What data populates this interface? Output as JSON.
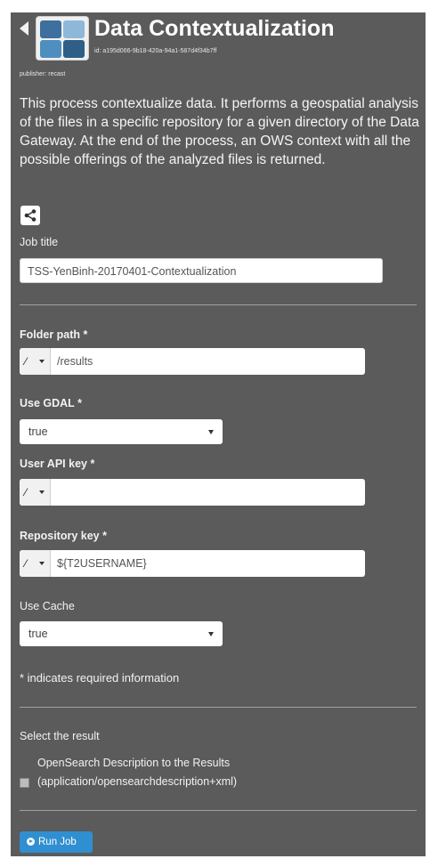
{
  "header": {
    "title": "Data Contextualization",
    "id_text": "id: a195d066-9b18-420a-94a1-587d4f34b7ff",
    "publisher": "publisher: recast"
  },
  "description": "This process contextualize data. It performs a geospatial analysis of the files in a specific repository for a given directory of the Data Gateway. At the end of the process, an OWS context with all the possible offerings of the analyzed files is returned.",
  "icons": {
    "back": "back-arrow-icon",
    "share": "share-icon",
    "wand": "magic-wand-icon",
    "run": "play-circle-icon"
  },
  "colors": {
    "panel_bg": "#5b5b5b",
    "run_button": "#2f8fd0"
  },
  "form": {
    "job_title": {
      "label": "Job title",
      "value": "TSS-YenBinh-20170401-Contextualization"
    },
    "folder_path": {
      "label": "Folder path *",
      "value": "/results"
    },
    "use_gdal": {
      "label": "Use GDAL *",
      "value": "true"
    },
    "user_api_key": {
      "label": "User API key *",
      "value": ""
    },
    "repository_key": {
      "label": "Repository key *",
      "value": "${T2USERNAME}"
    },
    "use_cache": {
      "label": "Use Cache",
      "value": "true"
    }
  },
  "required_note": "* indicates required information",
  "results": {
    "title": "Select the result",
    "option_line1": "OpenSearch Description to the Results",
    "option_line2": "(application/opensearchdescription+xml)"
  },
  "run_button": "Run Job"
}
